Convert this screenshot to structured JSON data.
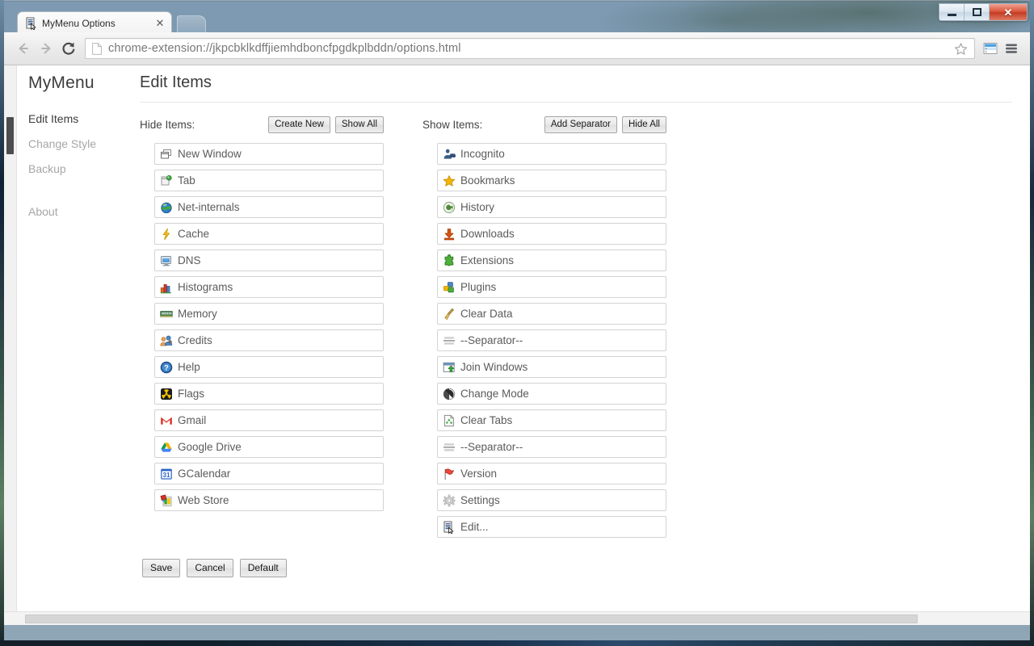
{
  "window": {
    "controls": {
      "minimize": "minimize",
      "maximize": "maximize",
      "close": "✕"
    }
  },
  "browser": {
    "tab": {
      "title": "MyMenu Options",
      "favicon": "document-cursor-icon",
      "close_label": "✕"
    },
    "new_tab_label": "",
    "nav": {
      "back": "back-icon",
      "forward": "forward-icon",
      "reload": "reload-icon"
    },
    "omnibox": {
      "url": "chrome-extension://jkpcbklkdffjiemhdboncfpgdkplbddn/options.html",
      "page_icon": "page-icon",
      "star_icon": "star-icon"
    },
    "toolbar_icons": [
      "extension-list-icon",
      "chrome-menu-icon"
    ]
  },
  "sidebar": {
    "brand": "MyMenu",
    "items": [
      {
        "label": "Edit Items",
        "active": true
      },
      {
        "label": "Change Style",
        "active": false
      },
      {
        "label": "Backup",
        "active": false
      },
      {
        "label": "About",
        "active": false
      }
    ]
  },
  "main": {
    "title": "Edit Items",
    "columns": [
      {
        "label": "Hide Items:",
        "buttons": [
          {
            "label": "Create New",
            "name": "create-new-button"
          },
          {
            "label": "Show All",
            "name": "show-all-button"
          }
        ],
        "items": [
          {
            "label": "New Window",
            "icon": "windows-icon"
          },
          {
            "label": "Tab",
            "icon": "tab-new-icon"
          },
          {
            "label": "Net-internals",
            "icon": "globe-icon"
          },
          {
            "label": "Cache",
            "icon": "lightning-icon"
          },
          {
            "label": "DNS",
            "icon": "monitor-icon"
          },
          {
            "label": "Histograms",
            "icon": "bar-chart-icon"
          },
          {
            "label": "Memory",
            "icon": "memory-chip-icon"
          },
          {
            "label": "Credits",
            "icon": "people-icon"
          },
          {
            "label": "Help",
            "icon": "question-circle-icon"
          },
          {
            "label": "Flags",
            "icon": "radiation-icon"
          },
          {
            "label": "Gmail",
            "icon": "gmail-icon"
          },
          {
            "label": "Google Drive",
            "icon": "google-drive-icon"
          },
          {
            "label": "GCalendar",
            "icon": "calendar-31-icon"
          },
          {
            "label": "Web Store",
            "icon": "web-store-icon"
          }
        ]
      },
      {
        "label": "Show Items:",
        "buttons": [
          {
            "label": "Add Separator",
            "name": "add-separator-button"
          },
          {
            "label": "Hide All",
            "name": "hide-all-button"
          }
        ],
        "items": [
          {
            "label": "Incognito",
            "icon": "incognito-icon"
          },
          {
            "label": "Bookmarks",
            "icon": "star-icon"
          },
          {
            "label": "History",
            "icon": "history-clock-icon"
          },
          {
            "label": "Downloads",
            "icon": "download-arrow-icon"
          },
          {
            "label": "Extensions",
            "icon": "puzzle-piece-icon"
          },
          {
            "label": "Plugins",
            "icon": "plugin-blocks-icon"
          },
          {
            "label": "Clear Data",
            "icon": "broom-icon"
          },
          {
            "label": "--Separator--",
            "icon": "separator-lines-icon"
          },
          {
            "label": "Join Windows",
            "icon": "join-windows-icon"
          },
          {
            "label": "Change Mode",
            "icon": "half-circle-icon"
          },
          {
            "label": "Clear Tabs",
            "icon": "recycle-page-icon"
          },
          {
            "label": "--Separator--",
            "icon": "separator-lines-icon"
          },
          {
            "label": "Version",
            "icon": "red-flag-icon"
          },
          {
            "label": "Settings",
            "icon": "gear-icon"
          },
          {
            "label": "Edit...",
            "icon": "document-cursor-icon"
          }
        ]
      }
    ],
    "footer_buttons": [
      {
        "label": "Save",
        "name": "save-button"
      },
      {
        "label": "Cancel",
        "name": "cancel-button"
      },
      {
        "label": "Default",
        "name": "default-button"
      }
    ]
  },
  "colors": {
    "accent": "#4a86c8",
    "active_text": "#3c3c3c",
    "muted_text": "#a6a6a6",
    "item_text": "#5b5b5b",
    "item_border": "#d3d3d3"
  }
}
